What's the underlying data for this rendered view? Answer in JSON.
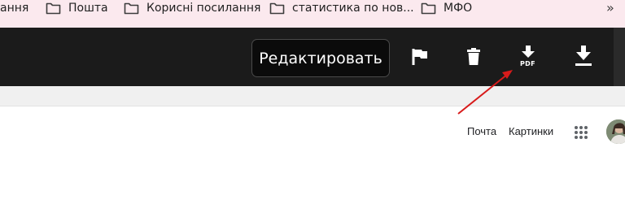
{
  "bookmarks": {
    "items": [
      {
        "label": "ання"
      },
      {
        "label": "Пошта"
      },
      {
        "label": "Корисні посилання"
      },
      {
        "label": "статистика по нов..."
      },
      {
        "label": "МФО"
      }
    ],
    "more_glyph": "»"
  },
  "toolbar": {
    "edit_label": "Редактировать",
    "icons": [
      "flag-icon",
      "trash-icon",
      "download-pdf-icon",
      "download-icon"
    ],
    "pdf_label": "PDF"
  },
  "google": {
    "mail_label": "Почта",
    "images_label": "Картинки",
    "apps_icon": "apps-grid-icon"
  },
  "colors": {
    "bookmarks_bg": "#fbe9ee",
    "toolbar_bg": "#1b1b1b",
    "annotation_arrow": "#d81b1b"
  }
}
